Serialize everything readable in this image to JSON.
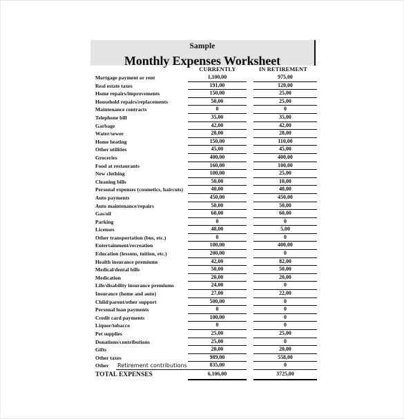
{
  "document": {
    "sample_label": "Sample",
    "title": "Monthly Expenses Worksheet"
  },
  "columns": {
    "label_header": "",
    "currently": "CURRENTLY",
    "in_retirement": "IN RETIREMENT"
  },
  "rows": [
    {
      "label": "Mortgage payment or rent",
      "currently": "1,100,00",
      "retirement": "975,00"
    },
    {
      "label": "Real estate taxes",
      "currently": "191,00",
      "retirement": "120,00"
    },
    {
      "label": "Home repairs/improvements",
      "currently": "150,00",
      "retirement": "25,00"
    },
    {
      "label": "Household repairs/replacements",
      "currently": "50,00",
      "retirement": "25,00"
    },
    {
      "label": "Maintenance contracts",
      "currently": "0",
      "retirement": "0"
    },
    {
      "label": "Telephone bill",
      "currently": "35,00",
      "retirement": "35,00"
    },
    {
      "label": "Garbage",
      "currently": "42,00",
      "retirement": "42,00"
    },
    {
      "label": "Water/sewer",
      "currently": "28,00",
      "retirement": "28,00"
    },
    {
      "label": "Home heating",
      "currently": "150,00",
      "retirement": "110,00"
    },
    {
      "label": "Other utilities",
      "currently": "45,00",
      "retirement": "45,00"
    },
    {
      "label": "Groceries",
      "currently": "400,00",
      "retirement": "400,00"
    },
    {
      "label": "Food at restaurants",
      "currently": "160,00",
      "retirement": "100,00"
    },
    {
      "label": "New clothing",
      "currently": "100,00",
      "retirement": "25,00"
    },
    {
      "label": "Cleaning bills",
      "currently": "50,00",
      "retirement": "10,00"
    },
    {
      "label": "Personal expenses (cosmetics, haircuts)",
      "currently": "40,00",
      "retirement": "40,00"
    },
    {
      "label": "Auto payments",
      "currently": "450,00",
      "retirement": "450,00"
    },
    {
      "label": "Auto maintenance/repairs",
      "currently": "50,00",
      "retirement": "50,00"
    },
    {
      "label": "Gas/oil",
      "currently": "60,00",
      "retirement": "60,00"
    },
    {
      "label": "Parking",
      "currently": "0",
      "retirement": "0"
    },
    {
      "label": "Licenses",
      "currently": "48,00",
      "retirement": "5,00"
    },
    {
      "label": "Other transportation (bus, etc.)",
      "currently": "0",
      "retirement": "0"
    },
    {
      "label": "Entertainment/recreation",
      "currently": "100,00",
      "retirement": "400,00"
    },
    {
      "label": "Education (lessons, tuition, etc.)",
      "currently": "200,00",
      "retirement": "0"
    },
    {
      "label": "Health insurance premiums",
      "currently": "42,00",
      "retirement": "82,00"
    },
    {
      "label": "Medical/dental bills",
      "currently": "50,00",
      "retirement": "50,00"
    },
    {
      "label": "Medication",
      "currently": "20,00",
      "retirement": "20,00"
    },
    {
      "label": "Life/disability insurance premiums",
      "currently": "24,00",
      "retirement": "0"
    },
    {
      "label": "Insurance (home and auto)",
      "currently": "27,00",
      "retirement": "22,00"
    },
    {
      "label": "Child/parent/other support",
      "currently": "500,00",
      "retirement": "0"
    },
    {
      "label": "Personal loan payments",
      "currently": "0",
      "retirement": "0"
    },
    {
      "label": "Credit card payments",
      "currently": "100,00",
      "retirement": "0"
    },
    {
      "label": "Liquor/tobacco",
      "currently": "0",
      "retirement": "0"
    },
    {
      "label": "Pet supplies",
      "currently": "25,00",
      "retirement": "25,00"
    },
    {
      "label": "Donations/contributions",
      "currently": "25,00",
      "retirement": "0"
    },
    {
      "label": "Gifts",
      "currently": "20,00",
      "retirement": "20,00"
    },
    {
      "label": "Other taxes",
      "currently": "989,00",
      "retirement": "558,00"
    }
  ],
  "other_row": {
    "label": "Other",
    "write_in_value": "Retirement contributions",
    "currently": "835,00",
    "retirement": "0"
  },
  "total_row": {
    "label": "TOTAL EXPENSES",
    "currently": "6,106,00",
    "retirement": "3725,00"
  },
  "colors": {
    "title_band": "#e4e4e4",
    "text": "#111111",
    "rule": "#0e0e0e"
  }
}
